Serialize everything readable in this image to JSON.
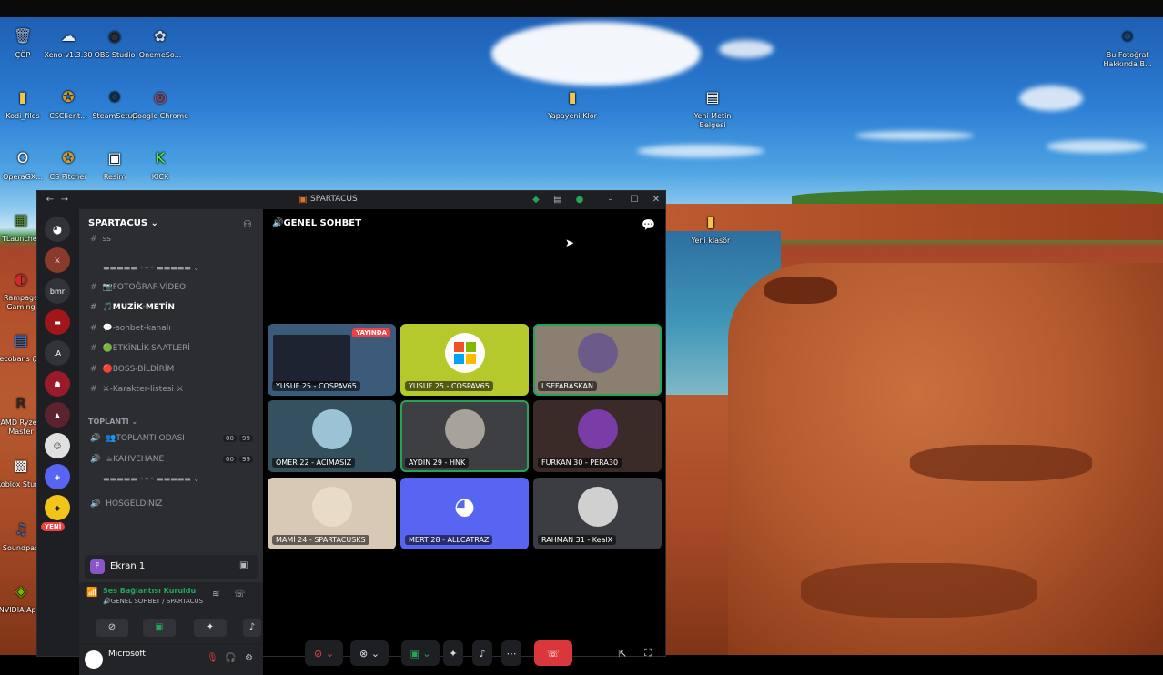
{
  "desktop": {
    "icons": [
      {
        "label": "ÇÖP",
        "icon": "recycle-bin-icon",
        "glyph": "🗑",
        "color": "#9bbbe0"
      },
      {
        "label": "Xeno-v1.3.30",
        "icon": "xeno-app-icon",
        "glyph": "☁",
        "color": "#e8eef7"
      },
      {
        "label": "OBS Studio",
        "icon": "obs-icon",
        "glyph": "◉",
        "color": "#302e31"
      },
      {
        "label": "OnemeSo...",
        "icon": "app-icon",
        "glyph": "✿",
        "color": "#d8d8e8"
      },
      {
        "label": "Kodi_files",
        "icon": "folder-icon",
        "glyph": "▮",
        "color": "#f2c84b"
      },
      {
        "label": "CSClient...",
        "icon": "game-icon",
        "glyph": "✪",
        "color": "#d19a2a"
      },
      {
        "label": "SteamSetup",
        "icon": "steam-icon",
        "glyph": "⚙",
        "color": "#1b2838"
      },
      {
        "label": "Google Chrome",
        "icon": "chrome-icon",
        "glyph": "◎",
        "color": "#e8453c"
      },
      {
        "label": "OperaGX...",
        "icon": "opera-gx-icon",
        "glyph": "O",
        "color": "#ffffff"
      },
      {
        "label": "CS Pitcher",
        "icon": "game-icon",
        "glyph": "✪",
        "color": "#d19a2a"
      },
      {
        "label": "Resim",
        "icon": "image-file-icon",
        "glyph": "▣",
        "color": "#ffffff"
      },
      {
        "label": "KICK",
        "icon": "kick-icon",
        "glyph": "K",
        "color": "#53fc18"
      },
      {
        "label": "TLauncher",
        "icon": "minecraft-icon",
        "glyph": "▦",
        "color": "#5d8c3a"
      },
      {
        "label": "Rampage Gaming",
        "icon": "rampage-icon",
        "glyph": "◐",
        "color": "#d8262d"
      },
      {
        "label": "ecobans (2)",
        "icon": "file-icon",
        "glyph": "▤",
        "color": "#2b79d4"
      },
      {
        "label": "AMD Ryzen Master",
        "icon": "amd-icon",
        "glyph": "R",
        "color": "#2b2b2b"
      },
      {
        "label": "Roblox Studio",
        "icon": "roblox-icon",
        "glyph": "▩",
        "color": "#ffffff"
      },
      {
        "label": "Soundpad",
        "icon": "soundpad-icon",
        "glyph": "♫",
        "color": "#2d6fd0"
      },
      {
        "label": "NVIDIA Ap...",
        "icon": "nvidia-icon",
        "glyph": "◈",
        "color": "#76b900"
      },
      {
        "label": "Yapayeni Klor",
        "icon": "folder-icon",
        "glyph": "▮",
        "color": "#f2c84b"
      },
      {
        "label": "Yeni Metin Belgesi",
        "icon": "text-file-icon",
        "glyph": "▤",
        "color": "#ffffff"
      },
      {
        "label": "Yeni klasör",
        "icon": "folder-icon",
        "glyph": "▮",
        "color": "#f2c84b"
      },
      {
        "label": "Bu Fotoğraf Hakkında B...",
        "icon": "camera-icon",
        "glyph": "⊙",
        "color": "#1e2a3a"
      }
    ]
  },
  "discord": {
    "window_title": "SPARTACUS",
    "server_name": "SPARTACUS ⌄",
    "servers": [
      "bmr",
      ".A",
      "YENİ"
    ],
    "channels": [
      {
        "prefix": "#",
        "name": "ss",
        "active": false
      },
      {
        "prefix": "",
        "name": "▬▬▬▬▬ ◦✧◦ ▬▬▬▬▬ ⌄",
        "active": false
      },
      {
        "prefix": "#",
        "name": "📷FOTOĞRAF-VİDEO",
        "active": false
      },
      {
        "prefix": "#",
        "name": "🎵MUZİK-METİN",
        "active": true
      },
      {
        "prefix": "#",
        "name": "💬-sohbet-kanalı",
        "active": false
      },
      {
        "prefix": "#",
        "name": "🟢ETKİNLİK-SAATLERİ",
        "active": false
      },
      {
        "prefix": "#",
        "name": "🔴BOSS-BİLDİRİM",
        "active": false
      },
      {
        "prefix": "#",
        "name": "⚔-Karakter-listesi ⚔",
        "active": false
      }
    ],
    "category_meeting": "TOPLANTI ⌄",
    "voice_channels": [
      {
        "name": "👥TOPLANTI ODASI",
        "badge1": "00",
        "badge2": "99"
      },
      {
        "name": "☕KAHVEHANE",
        "badge1": "00",
        "badge2": "99"
      }
    ],
    "divider2": "▬▬▬▬▬ ◦✧◦ ▬▬▬▬▬ ⌄",
    "welcome_channel": "HOSGELDINIZ",
    "screen_share_label": "Ekran 1",
    "voice_status": "Ses Bağlantısı Kuruldu",
    "voice_channel_path": "🔊GENEL SOHBET / SPARTACUS",
    "user_name": "Microsoft",
    "active_channel_header": "🔊GENEL SOHBET",
    "tiles": [
      {
        "name": "YUSUF 25 - COSPAV65",
        "type": "stream",
        "live": "YAYINDA",
        "bg": "#3c5a7a"
      },
      {
        "name": "YUSUF 25 - COSPAV65",
        "type": "windows",
        "bg": "#b6c92c"
      },
      {
        "name": "I SEFABASKAN",
        "type": "avatar",
        "bg": "#8b7f72",
        "avatar": "#6b5a8a",
        "speaking": true
      },
      {
        "name": "ÖMER 22 - ACIMASIZ",
        "type": "avatar",
        "bg": "#35505e",
        "avatar": "#9cc3d5"
      },
      {
        "name": "AYDIN 29 - HNK",
        "type": "avatar",
        "bg": "#3d3f43",
        "avatar": "#a7a39a",
        "speaking": true
      },
      {
        "name": "FURKAN 30 - PERA30",
        "type": "avatar",
        "bg": "#3a2b28",
        "avatar": "#7a3da8"
      },
      {
        "name": "MAMİ 24 - SPARTACUSKS",
        "type": "avatar",
        "bg": "#d8c9b6",
        "avatar": "#e8dcc8"
      },
      {
        "name": "MERT 28 - ALLCATRAZ",
        "type": "discord",
        "bg": "#5865f2"
      },
      {
        "name": "RAHMAN 31 - KealX",
        "type": "avatar",
        "bg": "#3b3d42",
        "avatar": "#d0d0d0"
      }
    ],
    "controls": [
      "mic-off",
      "video-off",
      "screen-share",
      "activities",
      "soundboard",
      "more",
      "disconnect"
    ]
  }
}
